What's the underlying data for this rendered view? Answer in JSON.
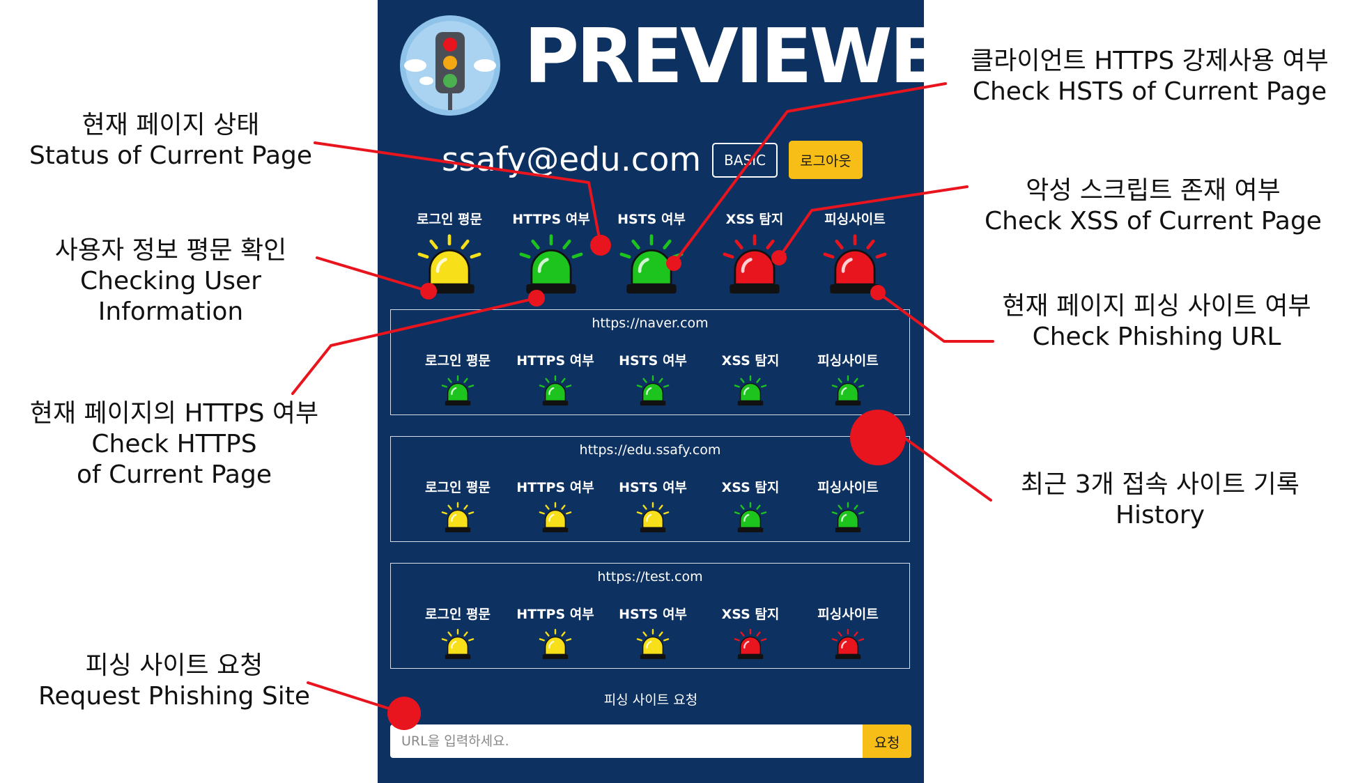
{
  "app": {
    "title": "PREVIEWER",
    "user_email": "ssafy@edu.com",
    "plan_badge": "BASIC",
    "logout_label": "로그아웃",
    "logo_icon": "traffic-light-icon"
  },
  "status_labels": [
    "로그인 평문",
    "HTTPS 여부",
    "HSTS 여부",
    "XSS 탐지",
    "피싱사이트"
  ],
  "colors": {
    "panel_bg": "#0d3160",
    "accent": "#f6be16",
    "siren_yellow": "#f7e01a",
    "siren_green": "#1ec41e",
    "siren_red": "#e8141e",
    "annotation_line": "#e8141e"
  },
  "current_status": [
    "yellow",
    "green",
    "green",
    "red",
    "red"
  ],
  "history": [
    {
      "url": "https://naver.com",
      "status": [
        "green",
        "green",
        "green",
        "green",
        "green"
      ]
    },
    {
      "url": "https://edu.ssafy.com",
      "status": [
        "yellow",
        "yellow",
        "yellow",
        "green",
        "green"
      ]
    },
    {
      "url": "https://test.com",
      "status": [
        "yellow",
        "yellow",
        "yellow",
        "red",
        "red"
      ]
    }
  ],
  "request": {
    "title": "피싱 사이트 요청",
    "placeholder": "URL을 입력하세요.",
    "button_label": "요청"
  },
  "annotations": {
    "status": {
      "ko": "현재 페이지 상태",
      "en": "Status of Current Page"
    },
    "user_info": {
      "ko": "사용자 정보 평문 확인",
      "en": "Checking User Information"
    },
    "https": {
      "ko": "현재 페이지의 HTTPS 여부",
      "en1": "Check HTTPS",
      "en2": "of Current Page"
    },
    "phishing_request": {
      "ko": "피싱 사이트 요청",
      "en": "Request Phishing Site"
    },
    "hsts": {
      "ko": "클라이언트 HTTPS 강제사용 여부",
      "en": "Check HSTS of Current Page"
    },
    "xss": {
      "ko": "악성 스크립트 존재 여부",
      "en": "Check XSS of Current Page"
    },
    "phishing_url": {
      "ko": "현재 페이지 피싱 사이트 여부",
      "en": "Check Phishing URL"
    },
    "history": {
      "ko": "최근 3개 접속 사이트 기록",
      "en": "History"
    }
  }
}
